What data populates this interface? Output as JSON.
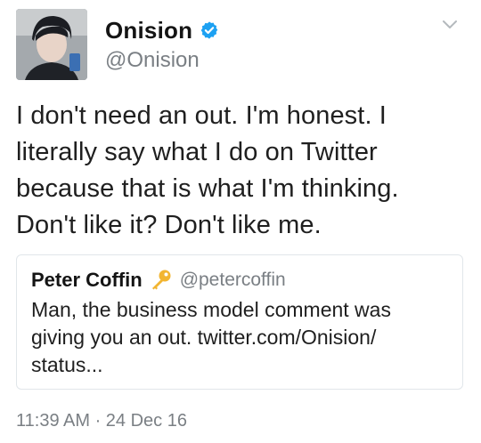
{
  "tweet": {
    "author": {
      "display_name": "Onision",
      "handle": "@Onision",
      "verified_icon": "verified-badge-icon"
    },
    "text_lines": [
      "I don't need an out. I'm honest. I",
      "literally say what I do on Twitter",
      "because that is what I'm thinking.",
      "Don't like it? Don't like me."
    ],
    "menu_icon": "chevron-down-icon",
    "timestamp": "11:39 AM · 24 Dec 16"
  },
  "quoted_tweet": {
    "display_name": "Peter Coffin",
    "handle": "@petercoffin",
    "emoji_icon": "key-emoji-icon",
    "text_lines": [
      "Man, the business model comment was",
      "giving you an out. twitter.com/Onision/",
      "status..."
    ]
  },
  "colors": {
    "verified": "#1da1f2",
    "secondary_text": "#7a7f84",
    "border": "#e1e6ea",
    "key": "#f2b531"
  }
}
